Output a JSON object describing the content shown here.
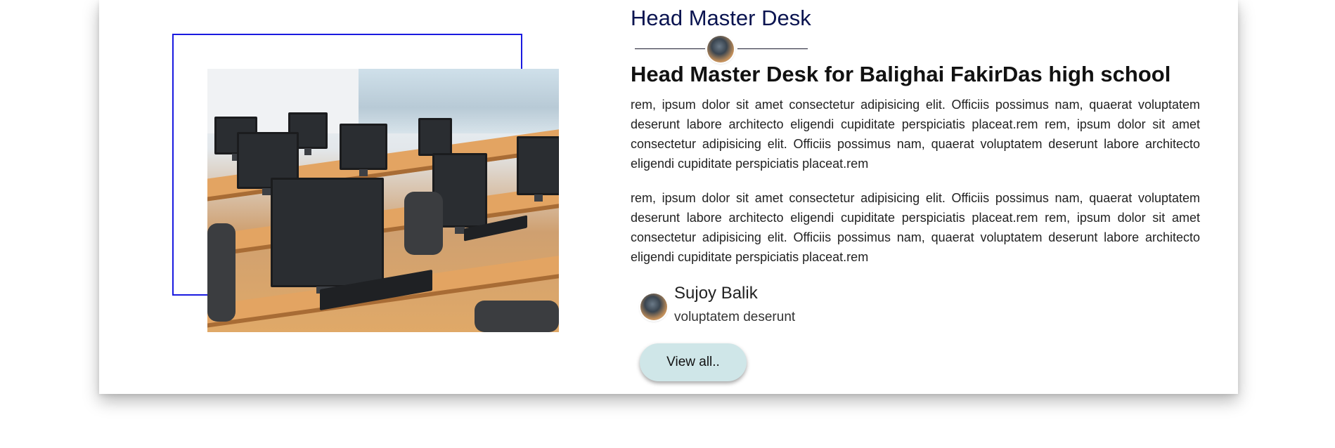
{
  "section": {
    "title": "Head Master Desk",
    "headline": "Head Master Desk for Balighai FakirDas high school",
    "paragraphs": [
      "rem, ipsum dolor sit amet consectetur adipisicing elit. Officiis possimus nam, quaerat voluptatem deserunt labore architecto eligendi cupiditate perspiciatis placeat.rem rem, ipsum dolor sit amet consectetur adipisicing elit. Officiis possimus nam, quaerat voluptatem deserunt labore architecto eligendi cupiditate perspiciatis placeat.rem",
      "rem, ipsum dolor sit amet consectetur adipisicing elit. Officiis possimus nam, quaerat voluptatem deserunt labore architecto eligendi cupiditate perspiciatis placeat.rem rem, ipsum dolor sit amet consectetur adipisicing elit. Officiis possimus nam, quaerat voluptatem deserunt labore architecto eligendi cupiditate perspiciatis placeat.rem"
    ],
    "author": {
      "name": "Sujoy Balik",
      "role": "voluptatem deserunt"
    },
    "button_label": "View all.."
  },
  "image": {
    "subject": "computer lab with desktop monitors on wooden desks"
  },
  "colors": {
    "frame": "#1a1ae0",
    "title": "#0a1450",
    "button_bg": "#cfe6e8"
  }
}
